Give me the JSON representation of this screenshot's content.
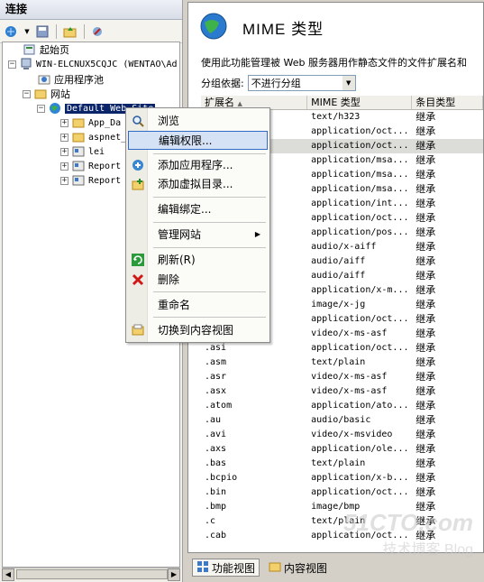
{
  "connections": {
    "title": "连接",
    "tree": [
      {
        "label": "起始页"
      },
      {
        "label": "WIN-ELCNUX5CQJC (WENTAO\\Ad"
      },
      {
        "label": "应用程序池"
      },
      {
        "label": "网站"
      },
      {
        "label": "Default Web Site"
      },
      {
        "label": "App_Da"
      },
      {
        "label": "aspnet_"
      },
      {
        "label": "lei"
      },
      {
        "label": "Report"
      },
      {
        "label": "Report"
      }
    ]
  },
  "mime": {
    "title": "MIME 类型",
    "description": "使用此功能管理被 Web 服务器用作静态文件的文件扩展名和",
    "group_label": "分组依据:",
    "group_value": "不进行分组",
    "columns": [
      "扩展名",
      "MIME 类型",
      "条目类型"
    ],
    "rows": [
      {
        "ext": "",
        "type": "text/h323",
        "entry": "继承"
      },
      {
        "ext": "",
        "type": "application/oct...",
        "entry": "继承"
      },
      {
        "ext": "",
        "type": "application/oct...",
        "entry": "继承"
      },
      {
        "ext": "",
        "type": "application/msa...",
        "entry": "继承"
      },
      {
        "ext": "",
        "type": "application/msa...",
        "entry": "继承"
      },
      {
        "ext": "",
        "type": "application/msa...",
        "entry": "继承"
      },
      {
        "ext": "",
        "type": "application/int...",
        "entry": "继承"
      },
      {
        "ext": "",
        "type": "application/oct...",
        "entry": "继承"
      },
      {
        "ext": "",
        "type": "application/pos...",
        "entry": "继承"
      },
      {
        "ext": "",
        "type": "audio/x-aiff",
        "entry": "继承"
      },
      {
        "ext": "",
        "type": "audio/aiff",
        "entry": "继承"
      },
      {
        "ext": "",
        "type": "audio/aiff",
        "entry": "继承"
      },
      {
        "ext": "",
        "type": "application/x-m...",
        "entry": "继承"
      },
      {
        "ext": "",
        "type": "image/x-jg",
        "entry": "继承"
      },
      {
        "ext": "",
        "type": "application/oct...",
        "entry": "继承"
      },
      {
        "ext": "",
        "type": "video/x-ms-asf",
        "entry": "继承"
      },
      {
        "ext": ".asi",
        "type": "application/oct...",
        "entry": "继承"
      },
      {
        "ext": ".asm",
        "type": "text/plain",
        "entry": "继承"
      },
      {
        "ext": ".asr",
        "type": "video/x-ms-asf",
        "entry": "继承"
      },
      {
        "ext": ".asx",
        "type": "video/x-ms-asf",
        "entry": "继承"
      },
      {
        "ext": ".atom",
        "type": "application/ato...",
        "entry": "继承"
      },
      {
        "ext": ".au",
        "type": "audio/basic",
        "entry": "继承"
      },
      {
        "ext": ".avi",
        "type": "video/x-msvideo",
        "entry": "继承"
      },
      {
        "ext": ".axs",
        "type": "application/ole...",
        "entry": "继承"
      },
      {
        "ext": ".bas",
        "type": "text/plain",
        "entry": "继承"
      },
      {
        "ext": ".bcpio",
        "type": "application/x-b...",
        "entry": "继承"
      },
      {
        "ext": ".bin",
        "type": "application/oct...",
        "entry": "继承"
      },
      {
        "ext": ".bmp",
        "type": "image/bmp",
        "entry": "继承"
      },
      {
        "ext": ".c",
        "type": "text/plain",
        "entry": "继承"
      },
      {
        "ext": ".cab",
        "type": "application/oct...",
        "entry": "继承"
      }
    ],
    "highlight_row": 2
  },
  "context_menu": {
    "items": [
      "浏览",
      "编辑权限...",
      "添加应用程序...",
      "添加虚拟目录...",
      "编辑绑定...",
      "管理网站",
      "刷新(R)",
      "删除",
      "重命名",
      "切换到内容视图"
    ]
  },
  "bottom_tabs": [
    "功能视图",
    "内容视图"
  ],
  "watermark": {
    "line1": "51CTO.com",
    "line2": "技术博客 Blog"
  },
  "colors": {
    "selection": "#0a246a",
    "menu_hover": "#d5e2f5",
    "menu_hover_border": "#316ac5",
    "row_highlight": "#dcdcd8"
  }
}
